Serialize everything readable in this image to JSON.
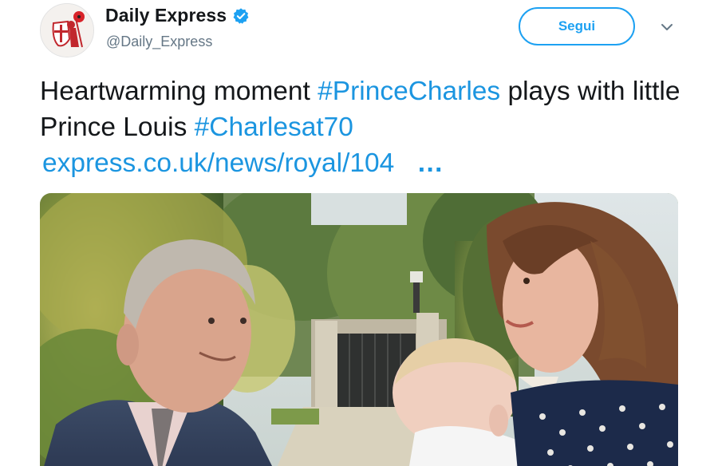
{
  "account": {
    "display_name": "Daily Express",
    "handle": "@Daily_Express",
    "verified_icon": "verified-badge-icon",
    "avatar_icon": "daily-express-crusader-logo-icon"
  },
  "actions": {
    "follow_label": "Segui",
    "menu_icon": "chevron-down-icon"
  },
  "tweet": {
    "text_part1": "Heartwarming moment ",
    "hashtag1": "#PrinceCharles",
    "text_part2": " plays with little Prince Louis ",
    "hashtag2": "#Charlesat70",
    "link": "express.co.uk/news/royal/104",
    "link_ellipsis": "…"
  },
  "media": {
    "description_icon": "photo-charles-louis-kate-image"
  },
  "colors": {
    "accent": "#1da1f2",
    "link": "#1b95e0",
    "text": "#14171a",
    "secondary": "#657786"
  }
}
